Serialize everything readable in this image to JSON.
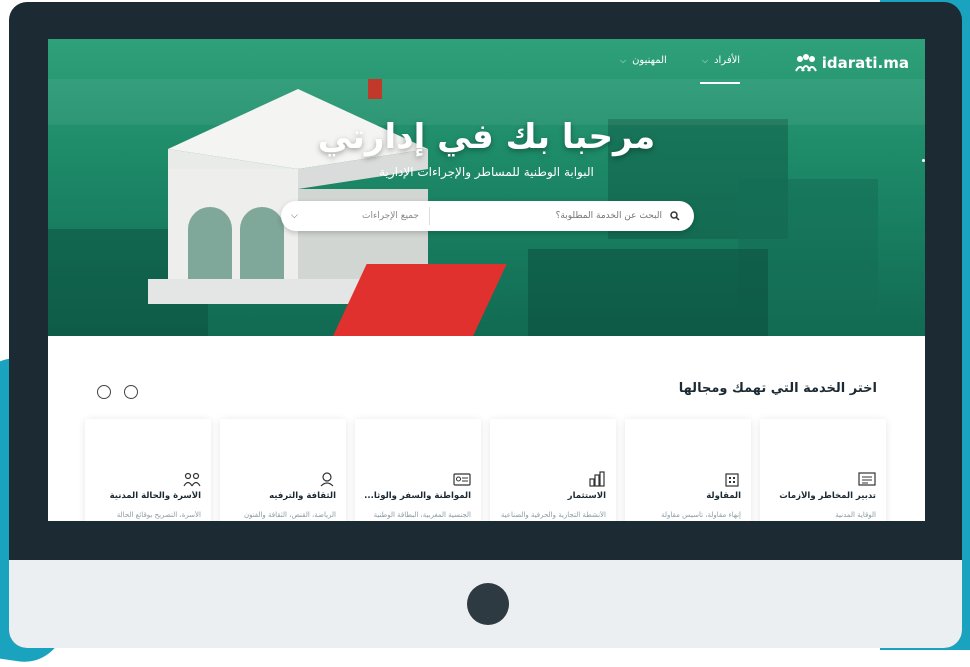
{
  "logo": {
    "text": "idarati.ma"
  },
  "nav": {
    "individuals": "الأفراد",
    "professionals": "المهنيون"
  },
  "hero": {
    "title": "مرحبا بك في إدارتي",
    "subtitle": "البوابة الوطنية للمساطر والإجراءات الإدارية"
  },
  "search": {
    "placeholder": "البحث عن الخدمة المطلوبة؟",
    "scope": "جميع الإجراءات"
  },
  "section": {
    "title": "اختر الخدمة التي تهمك ومجالها"
  },
  "cards": [
    {
      "title": "تدبير المخاطر والأزمات",
      "desc": "الوقاية المدنية",
      "icon": "crisis-icon"
    },
    {
      "title": "المقاولة",
      "desc": "إنهاء مقاولة، تأسيس مقاولة",
      "icon": "business-icon"
    },
    {
      "title": "الاستثمار",
      "desc": "الأنشطة التجارية والحرفية والصناعية",
      "icon": "investment-icon"
    },
    {
      "title": "المواطنة والسفر والوثا...",
      "desc": "الجنسية المغربية، البطاقة الوطنية",
      "icon": "citizenship-icon"
    },
    {
      "title": "الثقافة والترفيه",
      "desc": "الرياضة، القنص، الثقافة والفنون",
      "icon": "culture-icon"
    },
    {
      "title": "الأسرة والحالة المدنية",
      "desc": "الأسرة، التصريح بوقائع الحالة",
      "icon": "family-icon"
    }
  ],
  "colors": {
    "hero_green": "#1d8a68",
    "accent_teal": "#1aa3bf",
    "carpet_red": "#e0312f"
  }
}
